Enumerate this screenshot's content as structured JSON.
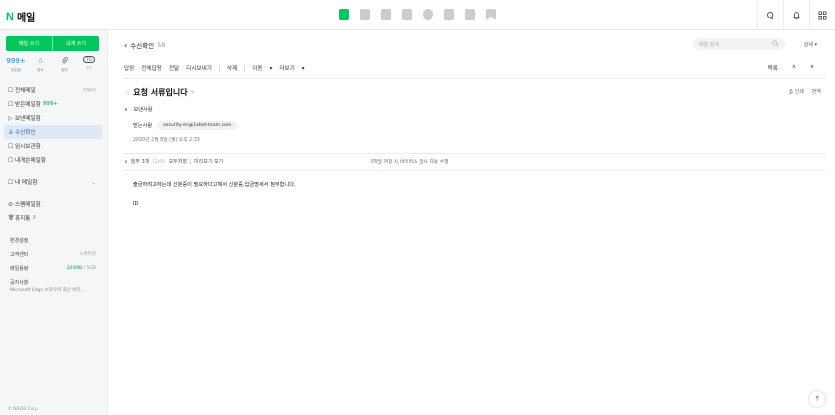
{
  "header": {
    "logo_n": "N",
    "logo_text": "메일",
    "apps": [
      "mail-app-icon",
      "calendar-app-icon",
      "contacts-app-icon",
      "memo-app-icon",
      "drive-app-icon",
      "todo-app-icon",
      "notes-app-icon",
      "bookmark-app-icon"
    ],
    "right_icons": [
      "chat-icon",
      "bell-icon",
      "grid-icon"
    ]
  },
  "sidebar": {
    "compose": "메일 쓰기",
    "self_mail": "내게 쓰기",
    "quick": [
      {
        "value": "999+",
        "label": "안읽음"
      },
      {
        "value": "☆",
        "label": "중요"
      },
      {
        "value": "📎",
        "label": "첨부"
      },
      {
        "value": "TO",
        "label": "TO"
      }
    ],
    "items": [
      {
        "icon": "☐",
        "label": "전체메일",
        "right": "전체읽기"
      },
      {
        "icon": "☐",
        "label": "받은메일함",
        "badge": "999+"
      },
      {
        "icon": "▷",
        "label": "보낸메일함"
      },
      {
        "icon": "♙",
        "label": "수신확인"
      },
      {
        "icon": "☐",
        "label": "임시보관함"
      },
      {
        "icon": "☐",
        "label": "내게쓴메일함"
      },
      {
        "icon": "☐",
        "label": "내 메일함"
      },
      {
        "icon": "⊘",
        "label": "스팸메일함"
      },
      {
        "icon": "🗑",
        "label": "휴지통",
        "count": "8"
      }
    ],
    "settings": "환경설정",
    "customer_center": "고객센터",
    "customer_right": "스마트봇",
    "capacity": "메일용량",
    "capacity_used": "204MB",
    "capacity_total": "/ 5GB",
    "notice_title": "공지사항",
    "notice_text": "Microsoft Edge 브라우저 최신 버전...",
    "copyright": "© NAVER Corp."
  },
  "main": {
    "folder": "수신확인",
    "count": "58",
    "search_placeholder": "메일 검색",
    "detail": "상세",
    "toolbar": [
      "답장",
      "전체답장",
      "전달",
      "다시보내기",
      "삭제",
      "이동",
      "더보기"
    ],
    "sort": "목록",
    "subject": "요청 서류입니다",
    "print": "인쇄",
    "translate": "번역",
    "from_label": "보낸사람",
    "to_label": "받는사람",
    "recipient": "security-en@1xbet-team.com",
    "date": "2020년 2월 8일 (월) 오후 2:33",
    "attach_label": "첨부 3개",
    "attach_size": "(1kB)",
    "save_all": "모두저장",
    "preview": "미리보기 보기",
    "virus_notice": "파일 저장 시 바이러스 검사 자동 수행",
    "body_line1": "출금하려고하는데 신분증이 필요하다고해서 신분증,입금명세서 첨부합니다.",
    "body_line2": "ID"
  }
}
